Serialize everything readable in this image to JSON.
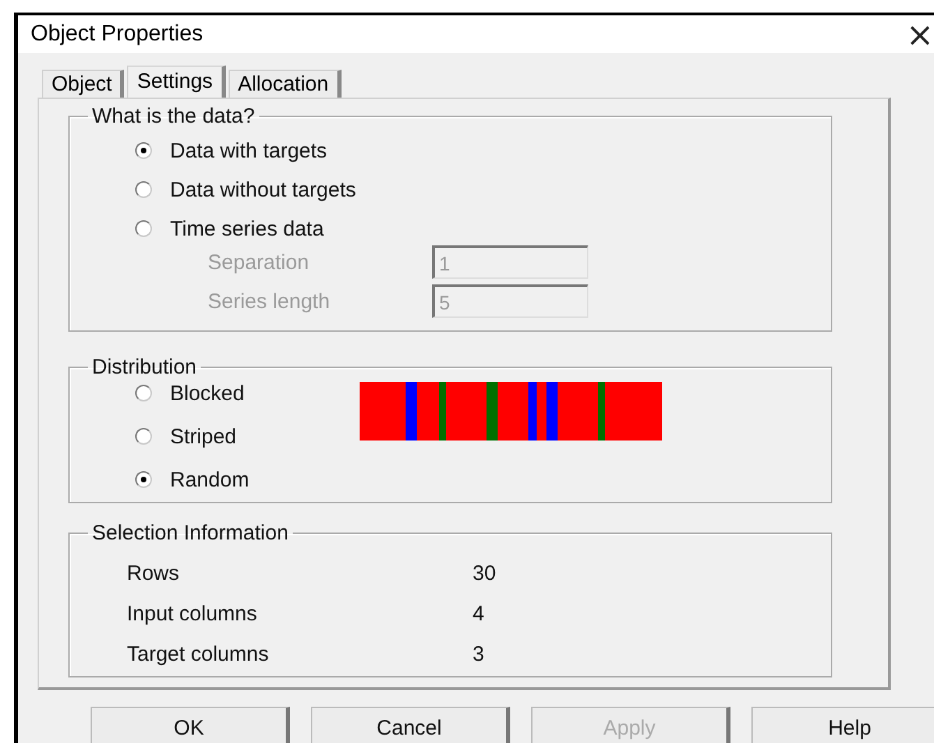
{
  "window": {
    "title": "Object Properties",
    "close": "×"
  },
  "tabs": [
    {
      "label": "Object",
      "selected": false
    },
    {
      "label": "Settings",
      "selected": true
    },
    {
      "label": "Allocation",
      "selected": false
    }
  ],
  "data_group": {
    "title": "What is the data?",
    "options": [
      {
        "label": "Data with targets",
        "selected": true
      },
      {
        "label": "Data without targets",
        "selected": false
      },
      {
        "label": "Time series data",
        "selected": false
      }
    ],
    "fields": [
      {
        "label": "Separation",
        "value": "1",
        "disabled": true
      },
      {
        "label": "Series length",
        "value": "5",
        "disabled": true
      }
    ]
  },
  "distribution": {
    "title": "Distribution",
    "options": [
      {
        "label": "Blocked",
        "selected": false
      },
      {
        "label": "Striped",
        "selected": false
      },
      {
        "label": "Random",
        "selected": true
      }
    ]
  },
  "selection_info": {
    "title": "Selection Information",
    "rows": [
      {
        "label": "Rows",
        "value": "30"
      },
      {
        "label": "Input columns",
        "value": "4"
      },
      {
        "label": "Target columns",
        "value": "3"
      }
    ]
  },
  "buttons": [
    {
      "label": "OK",
      "disabled": false
    },
    {
      "label": "Cancel",
      "disabled": false
    },
    {
      "label": "Apply",
      "disabled": true
    },
    {
      "label": "Help",
      "disabled": false
    }
  ]
}
